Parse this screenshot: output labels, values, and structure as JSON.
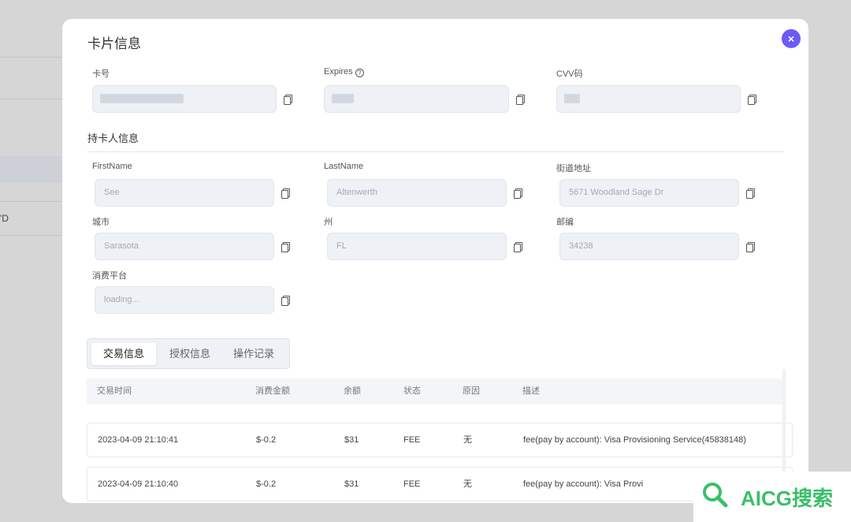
{
  "modal": {
    "title": "卡片信息",
    "close_label": "×"
  },
  "card": {
    "number_label": "卡号",
    "number_value": "",
    "expires_label": "Expires",
    "expires_value": "",
    "cvv_label": "CVV码",
    "cvv_value": ""
  },
  "holder": {
    "section_title": "持卡人信息",
    "first_name_label": "FirstName",
    "first_name_value": "See",
    "last_name_label": "LastName",
    "last_name_value": "Altenwerth",
    "street_label": "街道地址",
    "street_value": "5671 Woodland Sage Dr",
    "city_label": "城市",
    "city_value": "Sarasota",
    "state_label": "州",
    "state_value": "FL",
    "zip_label": "邮编",
    "zip_value": "34238",
    "platform_label": "消费平台",
    "platform_placeholder": "loading..."
  },
  "tabs": [
    "交易信息",
    "授权信息",
    "操作记录"
  ],
  "table": {
    "headers": [
      "交易时间",
      "消费金额",
      "余额",
      "状态",
      "原因",
      "描述"
    ],
    "rows": [
      [
        "2023-04-09 21:10:41",
        "$-0.2",
        "$31",
        "FEE",
        "无",
        "fee(pay by account): Visa Provisioning Service(45838148)"
      ],
      [
        "2023-04-09 21:10:40",
        "$-0.2",
        "$31",
        "FEE",
        "无",
        "fee(pay by account): Visa Provi"
      ]
    ]
  },
  "background": {
    "fragment": "'D"
  },
  "watermark": {
    "text": "AICG搜索"
  },
  "colors": {
    "accent": "#6a5cf6",
    "field_bg": "#eef1f6",
    "watermark": "#3bbf6a"
  }
}
